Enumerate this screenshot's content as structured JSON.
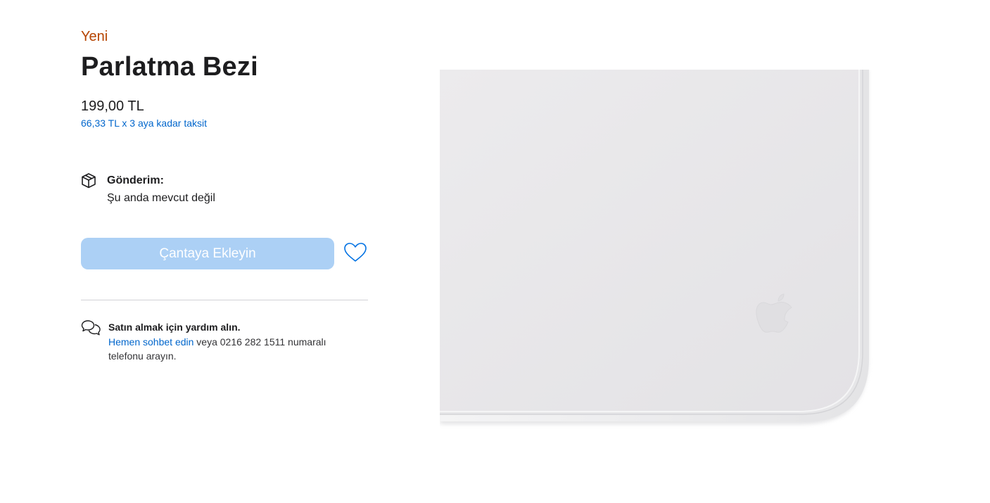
{
  "product": {
    "badge": "Yeni",
    "title": "Parlatma Bezi",
    "price": "199,00 TL",
    "installment": "66,33 TL x 3 aya kadar taksit"
  },
  "delivery": {
    "icon": "box-icon",
    "label": "Gönderim:",
    "status": "Şu anda mevcut değil"
  },
  "actions": {
    "add_to_bag_label": "Çantaya Ekleyin",
    "add_to_bag_disabled": true,
    "favorite_icon": "heart-icon"
  },
  "help": {
    "icon": "chat-bubbles-icon",
    "title": "Satın almak için yardım alın.",
    "chat_link": "Hemen sohbet edin",
    "text_after_link": " veya 0216 282 1511 numaralı telefonu arayın."
  },
  "colors": {
    "badge_orange": "#b64400",
    "link_blue": "#0066cc",
    "button_disabled_blue": "#acd0f5",
    "heart_blue": "#0071e3"
  }
}
